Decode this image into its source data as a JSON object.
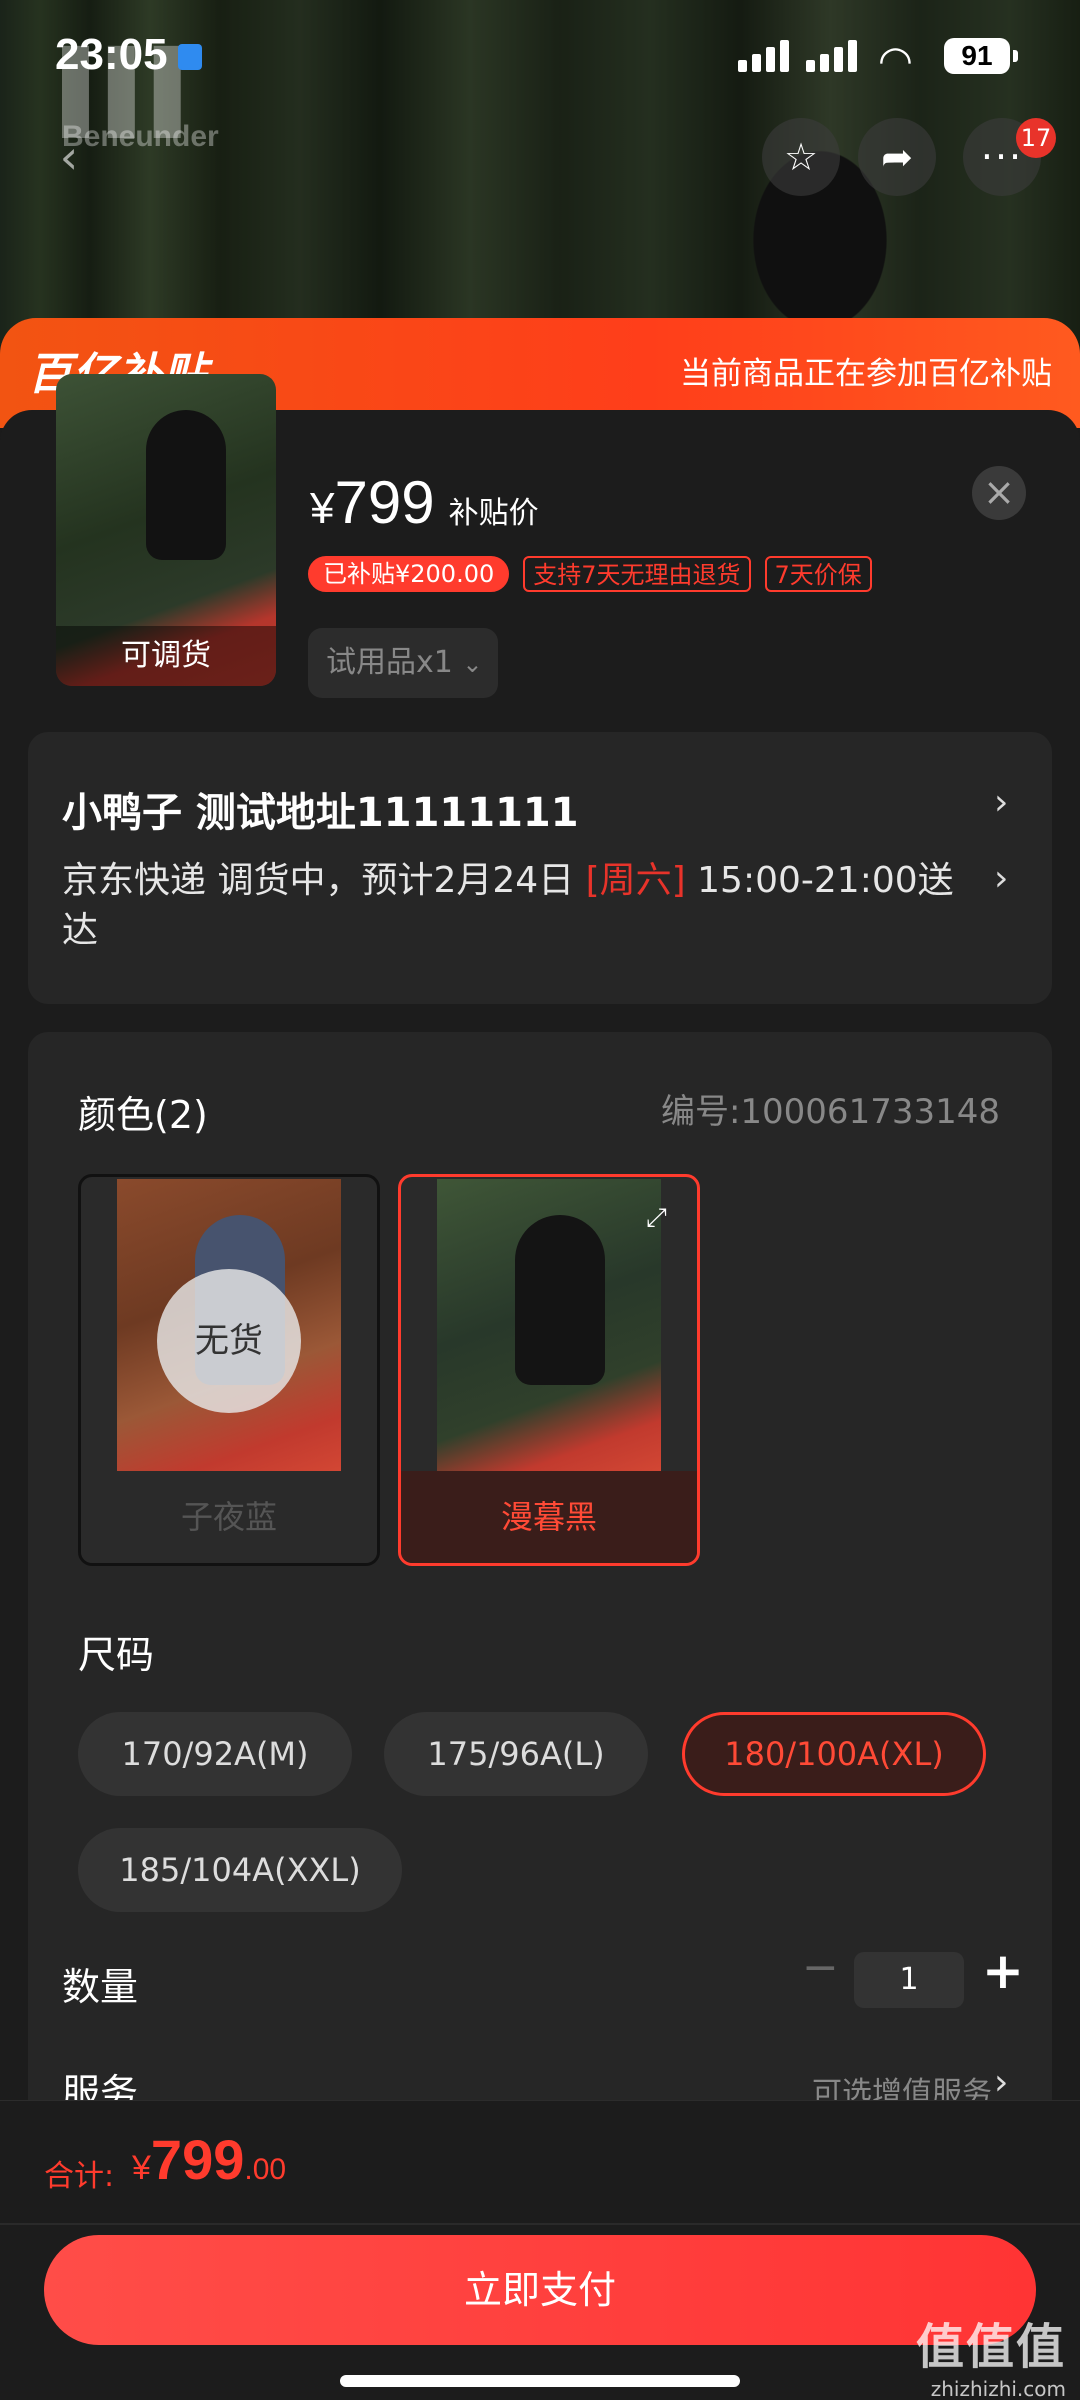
{
  "status_bar": {
    "time": "23:05",
    "battery": "91"
  },
  "background": {
    "brand_logo_text": "Beneunder"
  },
  "nav": {
    "badge_count": "17"
  },
  "promo": {
    "logo": "百亿补贴",
    "text": "当前商品正在参加百亿补贴"
  },
  "product": {
    "thumb_label": "可调货",
    "price_symbol": "¥",
    "price": "799",
    "price_label": "补贴价",
    "tags": [
      "已补贴¥200.00",
      "支持7天无理由退货",
      "7天价保"
    ],
    "trial_label": "试用品x1"
  },
  "address": {
    "line": "小鸭子  测试地址11111111",
    "delivery_prefix": "京东快递 调货中，预计2月24日 ",
    "delivery_weekday": "[周六]",
    "delivery_suffix": " 15:00-21:00送达"
  },
  "color": {
    "title": "颜色(2)",
    "code": "编号:100061733148",
    "options": [
      {
        "label": "子夜蓝",
        "status": "无货"
      },
      {
        "label": "漫暮黑"
      }
    ]
  },
  "size": {
    "title": "尺码",
    "options": [
      "170/92A(M)",
      "175/96A(L)",
      "180/100A(XL)",
      "185/104A(XXL)"
    ],
    "selected": "180/100A(XL)"
  },
  "quantity": {
    "title": "数量",
    "value": "1"
  },
  "service": {
    "title": "服务",
    "hint": "可选增值服务"
  },
  "footer": {
    "total_label": "合计:",
    "total_symbol": "¥",
    "total_int": "799",
    "total_dec": ".00",
    "pay_button": "立即支付",
    "watermark": "值值值",
    "watermark_url": "zhizhizhi.com"
  },
  "colors": {
    "accent": "#ff3b2d",
    "promo": "#f25412",
    "background": "#1c1c1c"
  }
}
